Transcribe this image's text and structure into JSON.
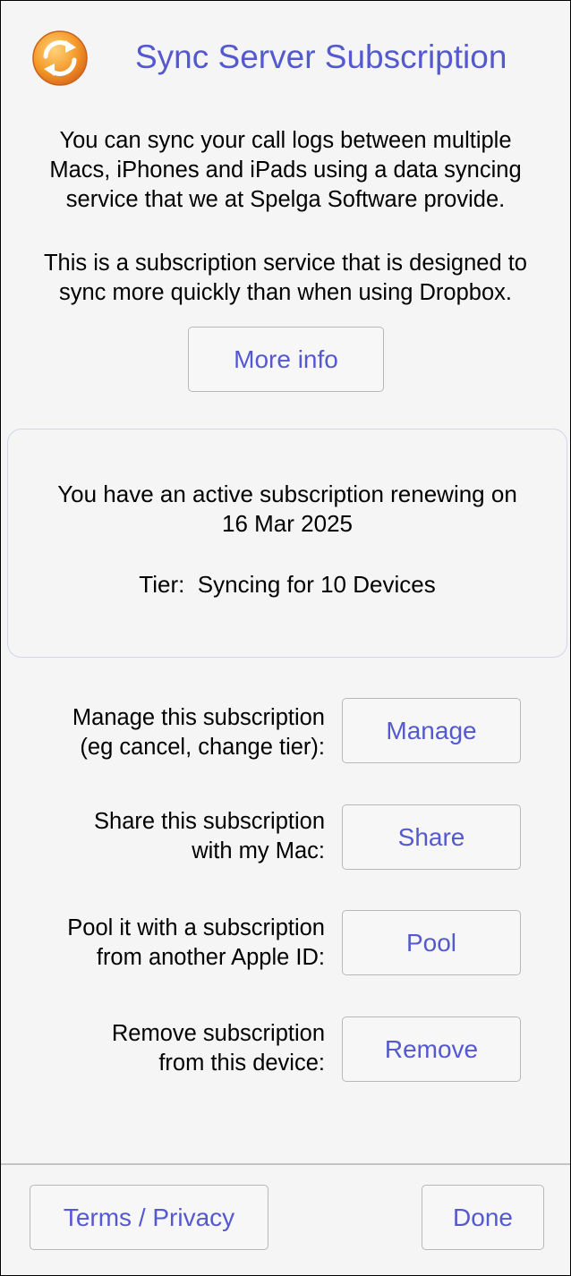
{
  "header": {
    "title": "Sync Server Subscription",
    "icon": "sync-refresh-icon"
  },
  "intro": {
    "line1": "You can sync your call logs between multiple",
    "line2": "Macs, iPhones and iPads using a data syncing",
    "line3": "service that we at Spelga Software provide.",
    "line4": "This is a subscription service that is designed to",
    "line5": "sync more quickly than when using Dropbox."
  },
  "more_info_label": "More info",
  "status": {
    "line1": "You have an active subscription renewing on",
    "line2": "16 Mar 2025",
    "tier_label": "Tier:",
    "tier_value": "Syncing for 10 Devices"
  },
  "actions": [
    {
      "label_line1": "Manage this subscription",
      "label_line2": "(eg cancel, change tier):",
      "button": "Manage"
    },
    {
      "label_line1": "Share this subscription",
      "label_line2": "with my Mac:",
      "button": "Share"
    },
    {
      "label_line1": "Pool it with a subscription",
      "label_line2": "from another Apple ID:",
      "button": "Pool"
    },
    {
      "label_line1": "Remove subscription",
      "label_line2": "from this device:",
      "button": "Remove"
    }
  ],
  "footer": {
    "terms_label": "Terms / Privacy",
    "done_label": "Done"
  },
  "colors": {
    "accent": "#5459cf",
    "icon_orange": "#f08a24",
    "border": "#b8b8b8"
  }
}
